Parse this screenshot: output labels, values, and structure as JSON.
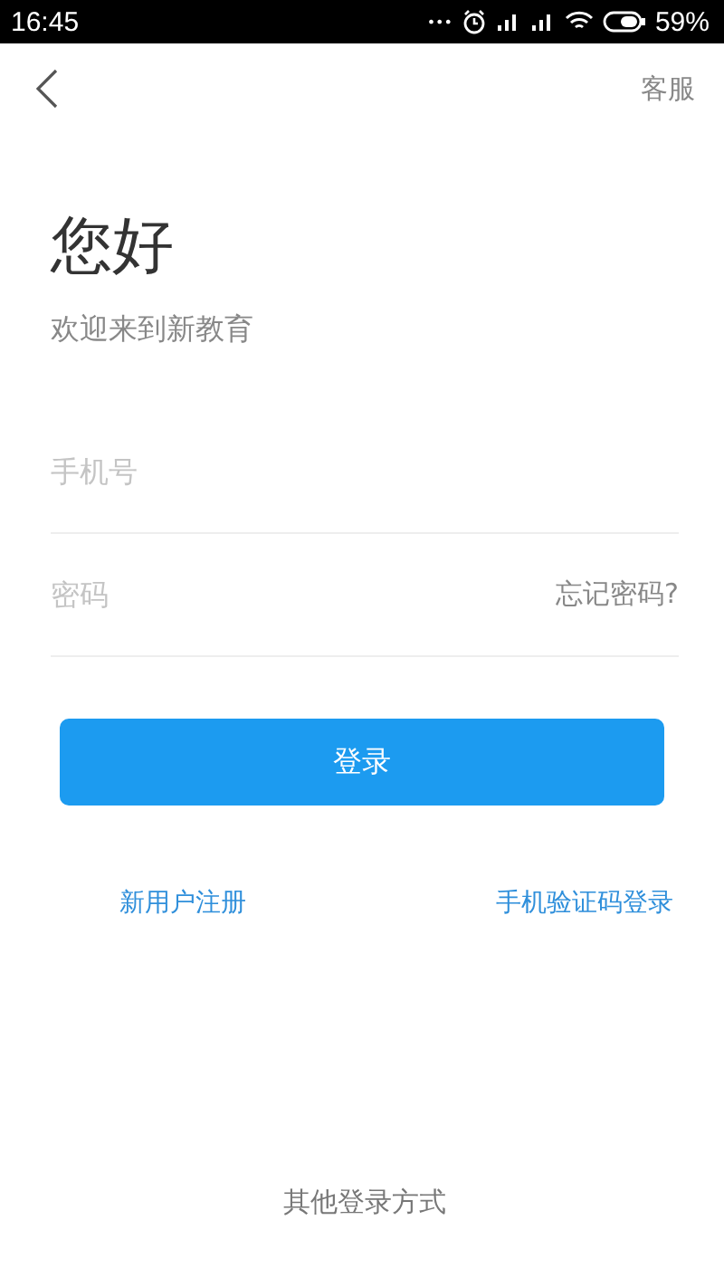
{
  "status_bar": {
    "time": "16:45",
    "dots": "•••",
    "battery": "59%"
  },
  "header": {
    "action": "客服"
  },
  "greeting": "您好",
  "subtitle": "欢迎来到新教育",
  "fields": [
    {
      "placeholder": "手机号"
    },
    {
      "placeholder": "密码",
      "link": "忘记密码?"
    }
  ],
  "login_button": "登录",
  "links": [
    "新用户注册",
    "手机验证码登录"
  ],
  "footer": "其他登录方式"
}
